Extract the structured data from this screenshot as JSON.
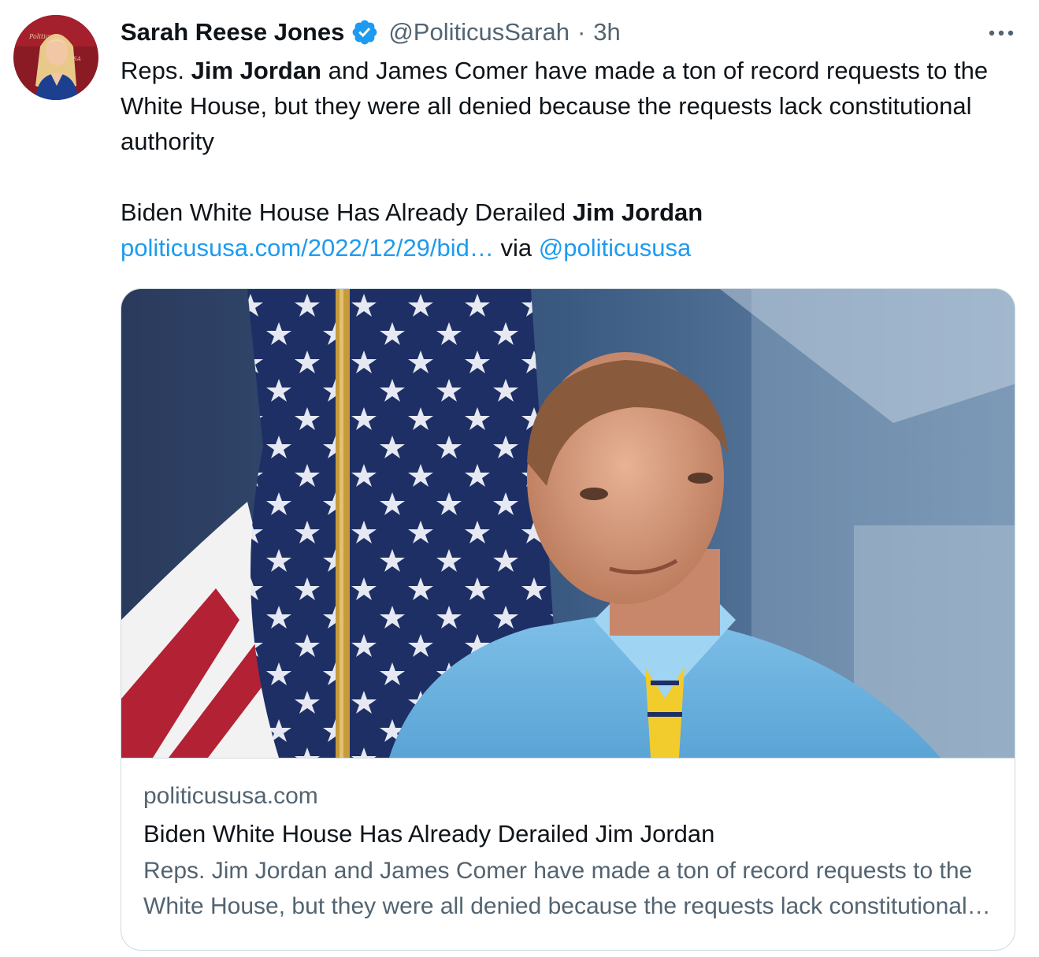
{
  "author": {
    "display_name": "Sarah Reese Jones",
    "handle": "@PoliticusSarah",
    "separator": "·",
    "time": "3h",
    "verified": true
  },
  "tweet": {
    "intro": "Reps.",
    "bold_name_1": "Jim Jordan",
    "sentence_rest": "and James Comer have made a ton of record requests to the White House, but they were all denied because the requests lack constitutional authority",
    "headline_text": "Biden White House Has Already Derailed",
    "bold_name_2": "Jim Jordan",
    "link_text": "politicususa.com/2022/12/29/bid…",
    "via_text": "via",
    "mention": "@politicususa"
  },
  "card": {
    "domain": "politicususa.com",
    "title": "Biden White House Has Already Derailed Jim Jordan",
    "description": "Reps. Jim Jordan and James Comer have made a ton of record requests to the White House, but they were all denied because the requests lack constitutional authority"
  },
  "icons": {
    "verified": "verified-badge-icon",
    "more": "more-options-icon"
  },
  "colors": {
    "link": "#1d9bf0",
    "secondary_text": "#536471",
    "primary_text": "#0f1419",
    "border": "#cfd9de"
  }
}
